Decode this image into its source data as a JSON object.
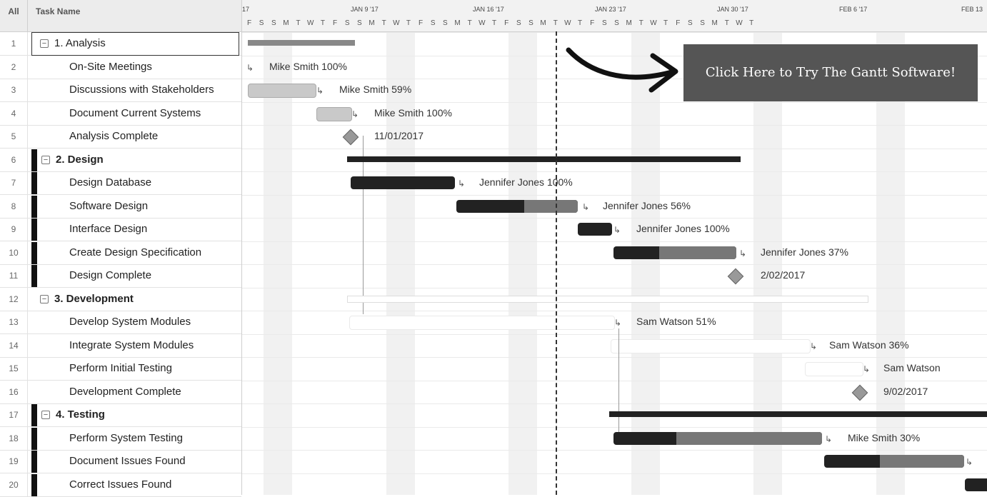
{
  "header": {
    "all_label": "All",
    "task_name_label": "Task Name"
  },
  "timeline": {
    "week_labels": [
      "17",
      "JAN 9 '17",
      "JAN 16 '17",
      "JAN 23 '17",
      "JAN 30 '17",
      "FEB 6 '17",
      "FEB 13"
    ],
    "day_letters": [
      "F",
      "S",
      "S",
      "M",
      "T",
      "W",
      "T",
      "F",
      "S",
      "S",
      "M",
      "T",
      "W",
      "T",
      "F",
      "S",
      "S",
      "M",
      "T",
      "W",
      "T",
      "F",
      "S",
      "S",
      "M",
      "T",
      "W",
      "T",
      "F",
      "S",
      "S",
      "M",
      "T",
      "W",
      "T",
      "F",
      "S",
      "S",
      "M",
      "T",
      "W",
      "T"
    ]
  },
  "tasks": [
    {
      "num": "1",
      "name": "1. Analysis",
      "group": true,
      "marker": false
    },
    {
      "num": "2",
      "name": "On-Site Meetings",
      "group": false,
      "marker": false
    },
    {
      "num": "3",
      "name": "Discussions with Stakeholders",
      "group": false,
      "marker": false
    },
    {
      "num": "4",
      "name": "Document Current Systems",
      "group": false,
      "marker": false
    },
    {
      "num": "5",
      "name": "Analysis Complete",
      "group": false,
      "marker": false
    },
    {
      "num": "6",
      "name": "2. Design",
      "group": true,
      "marker": true
    },
    {
      "num": "7",
      "name": "Design Database",
      "group": false,
      "marker": true
    },
    {
      "num": "8",
      "name": "Software Design",
      "group": false,
      "marker": true
    },
    {
      "num": "9",
      "name": "Interface Design",
      "group": false,
      "marker": true
    },
    {
      "num": "10",
      "name": "Create Design Specification",
      "group": false,
      "marker": true
    },
    {
      "num": "11",
      "name": "Design Complete",
      "group": false,
      "marker": true
    },
    {
      "num": "12",
      "name": "3. Development",
      "group": true,
      "marker": false
    },
    {
      "num": "13",
      "name": "Develop System Modules",
      "group": false,
      "marker": false
    },
    {
      "num": "14",
      "name": "Integrate System Modules",
      "group": false,
      "marker": false
    },
    {
      "num": "15",
      "name": "Perform Initial Testing",
      "group": false,
      "marker": false
    },
    {
      "num": "16",
      "name": "Development Complete",
      "group": false,
      "marker": false
    },
    {
      "num": "17",
      "name": "4. Testing",
      "group": true,
      "marker": true
    },
    {
      "num": "18",
      "name": "Perform System Testing",
      "group": false,
      "marker": true
    },
    {
      "num": "19",
      "name": "Document Issues Found",
      "group": false,
      "marker": true
    },
    {
      "num": "20",
      "name": "Correct Issues Found",
      "group": false,
      "marker": true
    }
  ],
  "bar_labels": {
    "r2": "Mike Smith  100%",
    "r3": "Mike Smith  59%",
    "r4": "Mike Smith  100%",
    "r5": "11/01/2017",
    "r7": "Jennifer Jones  100%",
    "r8": "Jennifer Jones  56%",
    "r9": "Jennifer Jones  100%",
    "r10": "Jennifer Jones  37%",
    "r11": "2/02/2017",
    "r13": "Sam Watson  51%",
    "r14": "Sam Watson  36%",
    "r15": "Sam Watson",
    "r16": "9/02/2017",
    "r18": "Mike Smith  30%"
  },
  "progress": {
    "r2": 1.0,
    "r3": 0.59,
    "r4": 1.0,
    "r7": 1.0,
    "r8": 0.56,
    "r9": 1.0,
    "r10": 0.37,
    "r13": 0.51,
    "r14": 0.36,
    "r18": 0.3
  },
  "cta": {
    "label": "Click Here to Try The Gantt Software!"
  },
  "colors": {
    "dark_bar": "#222222",
    "gray_bar": "#c9c9c9",
    "cta_bg": "#555555"
  }
}
